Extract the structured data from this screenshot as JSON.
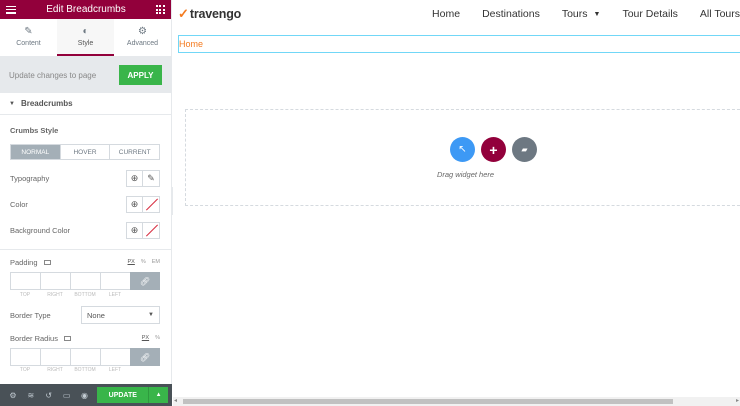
{
  "panel": {
    "title": "Edit Breadcrumbs",
    "tabs": [
      {
        "label": "Content",
        "icon": "pencil-icon"
      },
      {
        "label": "Style",
        "icon": "half-circle-icon"
      },
      {
        "label": "Advanced",
        "icon": "gear-icon"
      }
    ],
    "active_tab": "Style",
    "update_text": "Update changes to page",
    "apply_label": "APPLY",
    "section_label": "Breadcrumbs",
    "crumbs_style_label": "Crumbs Style",
    "state_tabs": [
      "NORMAL",
      "HOVER",
      "CURRENT"
    ],
    "active_state": "NORMAL",
    "typography_label": "Typography",
    "color_label": "Color",
    "background_color_label": "Background Color",
    "padding": {
      "label": "Padding",
      "units": [
        "PX",
        "%",
        "EM"
      ],
      "active_unit": "PX",
      "sides": [
        "TOP",
        "RIGHT",
        "BOTTOM",
        "LEFT"
      ]
    },
    "border_type": {
      "label": "Border Type",
      "value": "None"
    },
    "border_radius": {
      "label": "Border Radius",
      "units": [
        "PX",
        "%"
      ],
      "active_unit": "PX",
      "sides": [
        "TOP",
        "RIGHT",
        "BOTTOM",
        "LEFT"
      ]
    },
    "footer": {
      "update_label": "UPDATE"
    }
  },
  "site": {
    "logo_text": "travengo",
    "nav": [
      "Home",
      "Destinations",
      "Tours",
      "Tour Details",
      "All Tours"
    ],
    "breadcrumb": "Home",
    "drag_text": "Drag widget here"
  },
  "colors": {
    "brand": "#92003b",
    "success": "#39b54a",
    "accent_orange": "#f47b20",
    "selection_outline": "#71d7f7"
  }
}
